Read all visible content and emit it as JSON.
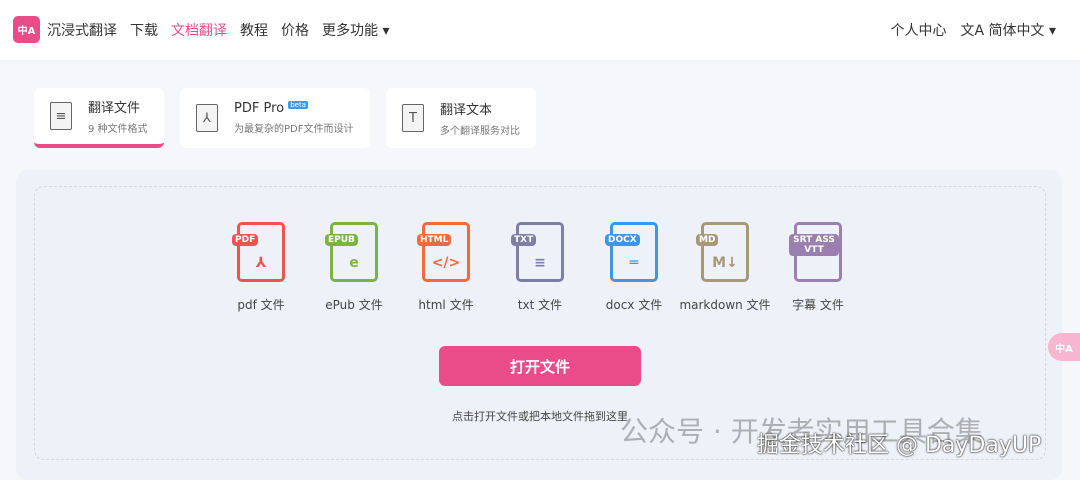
{
  "header": {
    "logo_text": "中A",
    "brand": "沉浸式翻译",
    "nav": [
      "下载",
      "文档翻译",
      "教程",
      "价格",
      "更多功能 ▾"
    ],
    "active_nav": 1,
    "right": [
      "个人中心",
      "文A 简体中文 ▾"
    ]
  },
  "tabs": [
    {
      "icon": "≡",
      "title": "翻译文件",
      "sub": "9 种文件格式"
    },
    {
      "icon": "⅄",
      "title": "PDF Pro",
      "badge": "beta",
      "sub": "为最复杂的PDF文件而设计"
    },
    {
      "icon": "T",
      "title": "翻译文本",
      "sub": "多个翻译服务对比"
    }
  ],
  "file_types": [
    {
      "label": "PDF",
      "glyph": "⅄",
      "name": "pdf 文件",
      "color": "#f05252"
    },
    {
      "label": "EPUB",
      "glyph": "e",
      "name": "ePub 文件",
      "color": "#7cb342"
    },
    {
      "label": "HTML",
      "glyph": "</>",
      "name": "html 文件",
      "color": "#f2693a"
    },
    {
      "label": "TXT",
      "glyph": "≡",
      "name": "txt 文件",
      "color": "#7e7fa5"
    },
    {
      "label": "DOCX",
      "glyph": "═",
      "name": "docx 文件",
      "color": "#3d96e8"
    },
    {
      "label": "MD",
      "glyph": "M↓",
      "name": "markdown 文件",
      "color": "#a8987a"
    },
    {
      "label": "SRT ASS VTT",
      "glyph": "",
      "name": "字幕 文件",
      "color": "#9a7fb0"
    }
  ],
  "open_button": "打开文件",
  "hint": "点击打开文件或把本地文件拖到这里",
  "float_button": "中A",
  "watermarks": [
    "公众号 · 开发者实用工具合集",
    "掘金技术社区 @ DayDayUP"
  ]
}
